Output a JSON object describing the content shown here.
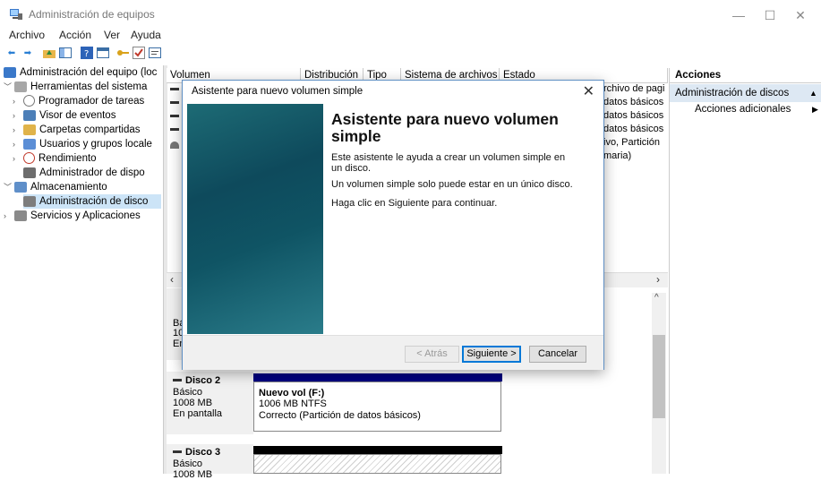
{
  "window": {
    "title": "Administración de equipos",
    "controls": {
      "minimize": "—",
      "maximize": "☐",
      "close": "✕"
    }
  },
  "menu": [
    "Archivo",
    "Acción",
    "Ver",
    "Ayuda"
  ],
  "tree": {
    "root": "Administración del equipo (loc",
    "system_tools": "Herramientas del sistema",
    "task_scheduler": "Programador de tareas",
    "event_viewer": "Visor de eventos",
    "shared_folders": "Carpetas compartidas",
    "users_groups": "Usuarios y grupos locale",
    "performance": "Rendimiento",
    "device_manager": "Administrador de dispo",
    "storage": "Almacenamiento",
    "disk_management": "Administración de disco",
    "services": "Servicios y Aplicaciones"
  },
  "volume_table": {
    "columns": [
      "Volumen",
      "Distribución",
      "Tipo",
      "Sistema de archivos",
      "Estado"
    ],
    "status_fragments": [
      "rchivo de pagi",
      "datos básicos",
      "datos básicos",
      "datos básicos",
      "ivo, Partición",
      "maria)"
    ]
  },
  "disks": [
    {
      "title": "Disco 2",
      "type": "Básico",
      "size": "1008 MB",
      "state": "En pantalla",
      "partition": {
        "name": "Nuevo vol (F:)",
        "detail": "1006 MB NTFS",
        "status": "Correcto (Partición de datos básicos)"
      }
    },
    {
      "title": "Disco 3",
      "type": "Básico",
      "size": "1008 MB"
    }
  ],
  "partial_disk": {
    "l1": "Bás",
    "l2": "100",
    "l3": "En"
  },
  "actions": {
    "header": "Acciones",
    "selected": "Administración de discos",
    "more": "Acciones adicionales"
  },
  "dialog": {
    "title": "Asistente para nuevo volumen simple",
    "heading": "Asistente para nuevo volumen simple",
    "p1": "Este asistente le ayuda a crear un volumen simple en un disco.",
    "p2": "Un volumen simple solo puede estar en un único disco.",
    "p3": "Haga clic en Siguiente para continuar.",
    "back": "< Atrás",
    "next": "Siguiente >",
    "cancel": "Cancelar"
  },
  "colors": {
    "accent": "#0078d7",
    "primary_partition": "#00007f",
    "unallocated": "#000000"
  }
}
